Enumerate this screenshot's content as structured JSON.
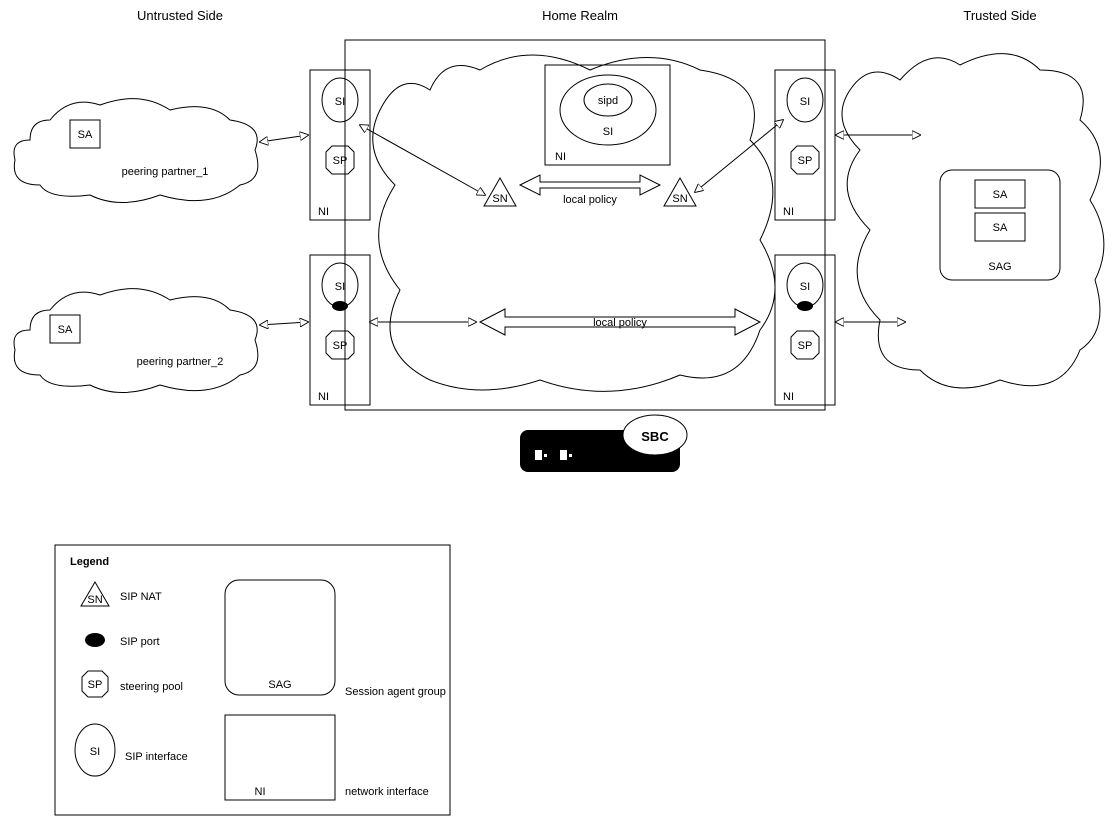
{
  "headers": {
    "untrusted": "Untrusted Side",
    "home": "Home Realm",
    "trusted": "Trusted Side"
  },
  "clouds": {
    "peering1": "peering partner_1",
    "peering2": "peering partner_2",
    "sag": "SAG"
  },
  "labels": {
    "sa": "SA",
    "si": "SI",
    "sp": "SP",
    "sn": "SN",
    "ni": "NI",
    "sipd": "sipd",
    "localpolicy": "local policy",
    "sbc": "SBC"
  },
  "legend": {
    "title": "Legend",
    "sipnat": "SIP NAT",
    "sipport": "SIP port",
    "steeringpool": "steering pool",
    "sipinterface": "SIP interface",
    "sag": "Session agent group",
    "ni": "network interface"
  }
}
